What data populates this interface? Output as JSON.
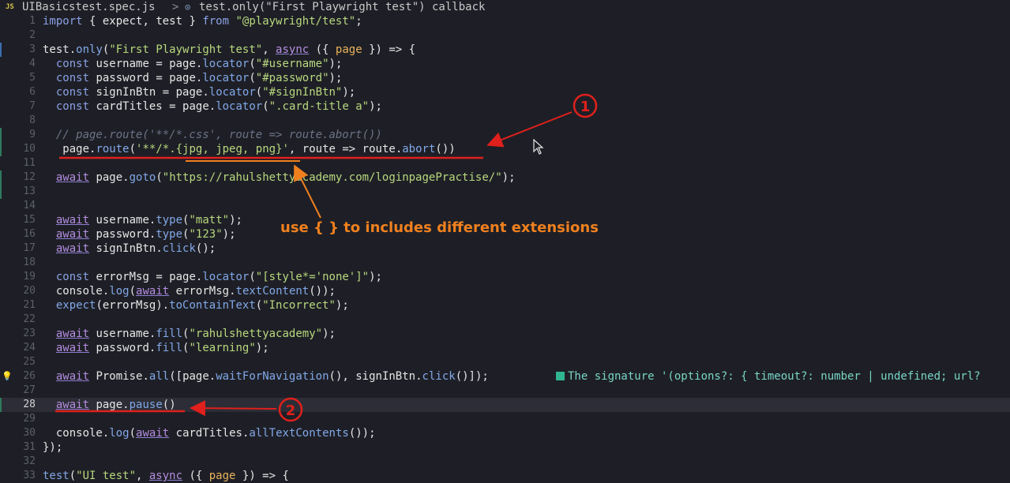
{
  "breadcrumb": {
    "file_icon": "JS",
    "file": "UIBasicstest.spec.js",
    "separator": ">",
    "symbol_icon": "⊙",
    "symbol": "test.only(\"First Playwright test\") callback"
  },
  "lines": [
    {
      "n": "1",
      "code": "import { expect, test } from \"@playwright/test\";"
    },
    {
      "n": "2",
      "code": ""
    },
    {
      "n": "3",
      "code": "test.only(\"First Playwright test\", async ({ page }) => {"
    },
    {
      "n": "4",
      "code": "  const username = page.locator(\"#username\");"
    },
    {
      "n": "5",
      "code": "  const password = page.locator(\"#password\");"
    },
    {
      "n": "6",
      "code": "  const signInBtn = page.locator(\"#signInBtn\");"
    },
    {
      "n": "7",
      "code": "  const cardTitles = page.locator(\".card-title a\");"
    },
    {
      "n": "8",
      "code": ""
    },
    {
      "n": "9",
      "code": "  // page.route('**/*.css', route => route.abort())"
    },
    {
      "n": "10",
      "code": "   page.route('**/*.{jpg, jpeg, png}', route => route.abort())"
    },
    {
      "n": "11",
      "code": ""
    },
    {
      "n": "12",
      "code": "  await page.goto(\"https://rahulshettyacademy.com/loginpagePractise/\");"
    },
    {
      "n": "13",
      "code": ""
    },
    {
      "n": "14",
      "code": ""
    },
    {
      "n": "15",
      "code": "  await username.type(\"matt\");"
    },
    {
      "n": "16",
      "code": "  await password.type(\"123\");"
    },
    {
      "n": "17",
      "code": "  await signInBtn.click();"
    },
    {
      "n": "18",
      "code": ""
    },
    {
      "n": "19",
      "code": "  const errorMsg = page.locator(\"[style*='none']\");"
    },
    {
      "n": "20",
      "code": "  console.log(await errorMsg.textContent());"
    },
    {
      "n": "21",
      "code": "  expect(errorMsg).toContainText(\"Incorrect\");"
    },
    {
      "n": "22",
      "code": ""
    },
    {
      "n": "23",
      "code": "  await username.fill(\"rahulshettyacademy\");"
    },
    {
      "n": "24",
      "code": "  await password.fill(\"learning\");"
    },
    {
      "n": "25",
      "code": ""
    },
    {
      "n": "26",
      "code": "  await Promise.all([page.waitForNavigation(), signInBtn.click()]);"
    },
    {
      "n": "27",
      "code": ""
    },
    {
      "n": "28",
      "code": "  await page.pause()"
    },
    {
      "n": "29",
      "code": ""
    },
    {
      "n": "30",
      "code": "  console.log(await cardTitles.allTextContents());"
    },
    {
      "n": "31",
      "code": "});"
    },
    {
      "n": "32",
      "code": ""
    },
    {
      "n": "33",
      "code": "test(\"UI test\", async ({ page }) => {"
    }
  ],
  "inline_hint": "The signature '(options?: { timeout?: number | undefined; url?",
  "annotation": {
    "marker_1": "1",
    "marker_2": "2",
    "note": "use { } to includes different extensions"
  },
  "colors": {
    "background": "#1e1f26",
    "annotation_red": "#e0201c",
    "annotation_orange": "#f0801e"
  },
  "current_line": "28"
}
